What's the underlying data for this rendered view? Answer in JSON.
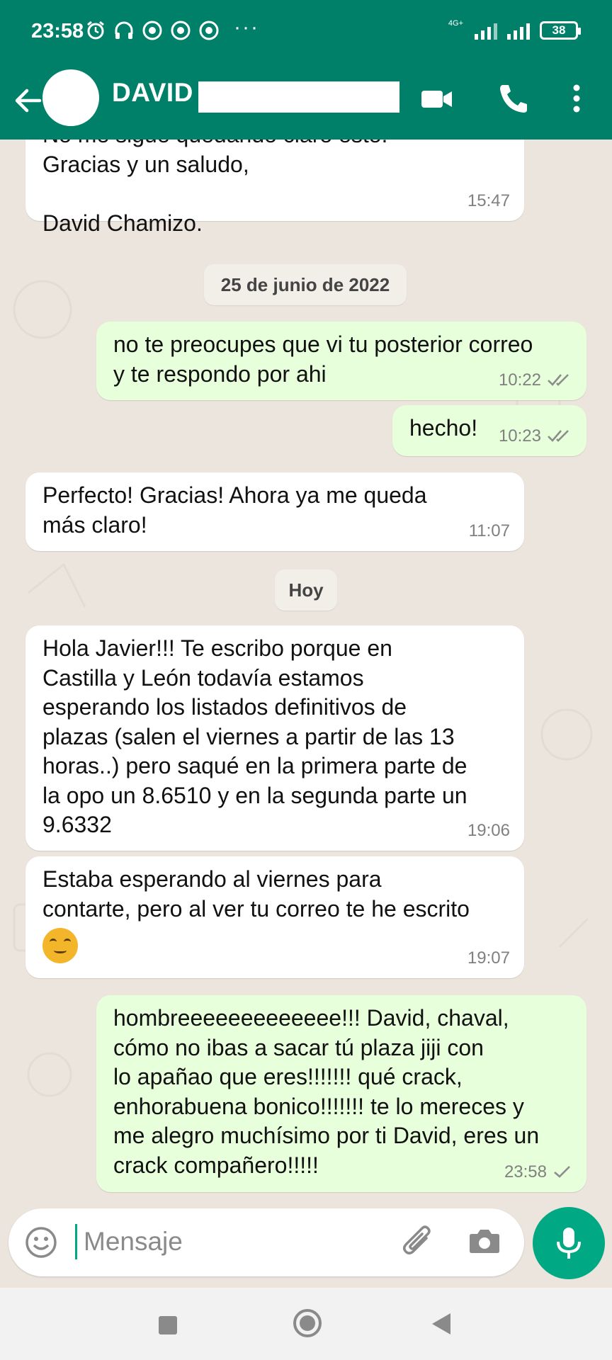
{
  "status_bar": {
    "time": "23:58",
    "icons": [
      "alarm-icon",
      "headphones-icon",
      "chrome-icon",
      "chrome-icon",
      "chrome-icon"
    ],
    "more": "···",
    "network": "4G+",
    "battery": "38"
  },
  "header": {
    "contact_name": "DAVID",
    "icons": [
      "back-arrow-icon",
      "video-call-icon",
      "phone-icon",
      "more-vert-icon"
    ]
  },
  "messages": [
    {
      "direction": "in",
      "text": "No me sigue quedando claro esto.\nGracias y un saludo,\n\nDavid Chamizo.",
      "time": "15:47"
    },
    {
      "type": "date",
      "text": "25 de junio de 2022"
    },
    {
      "direction": "out",
      "text": "no te preocupes que vi tu posterior correo\ny te respondo por ahi",
      "time": "10:22",
      "status": "read"
    },
    {
      "direction": "out",
      "text": "hecho!",
      "time": "10:23",
      "status": "read"
    },
    {
      "direction": "in",
      "text": "Perfecto! Gracias! Ahora ya me queda\nmás claro!",
      "time": "11:07"
    },
    {
      "type": "date",
      "text": "Hoy"
    },
    {
      "direction": "in",
      "text": "Hola Javier!!! Te escribo porque en\nCastilla y León todavía estamos\nesperando los listados definitivos de\nplazas (salen el viernes a partir de las 13\nhoras..) pero saqué en la primera parte de\nla opo un 8.6510 y en la segunda parte un\n9.6332",
      "time": "19:06"
    },
    {
      "direction": "in",
      "text": "Estaba esperando al viernes para\ncontarte, pero al ver tu correo te he escrito",
      "emoji": "upside-down-face-emoji",
      "time": "19:07"
    },
    {
      "direction": "out",
      "text": "hombreeeeeeeeeeeee!!! David, chaval,\ncómo no ibas a sacar tú plaza jiji con\nlo apañao que eres!!!!!!! qué crack,\nenhorabuena bonico!!!!!!! te lo mereces y\nme alegro muchísimo por ti David, eres un\ncrack compañero!!!!!",
      "time": "23:58",
      "status": "sent"
    }
  ],
  "composer": {
    "placeholder": "Mensaje",
    "icons": [
      "emoji-icon",
      "attach-icon",
      "camera-icon",
      "mic-icon"
    ],
    "accent": "#00a884"
  },
  "colors": {
    "header": "#008069",
    "incoming": "#ffffff",
    "outgoing": "#e7ffdb",
    "wallpaper": "#ece5dd",
    "read_tick": "#53bdeb"
  }
}
